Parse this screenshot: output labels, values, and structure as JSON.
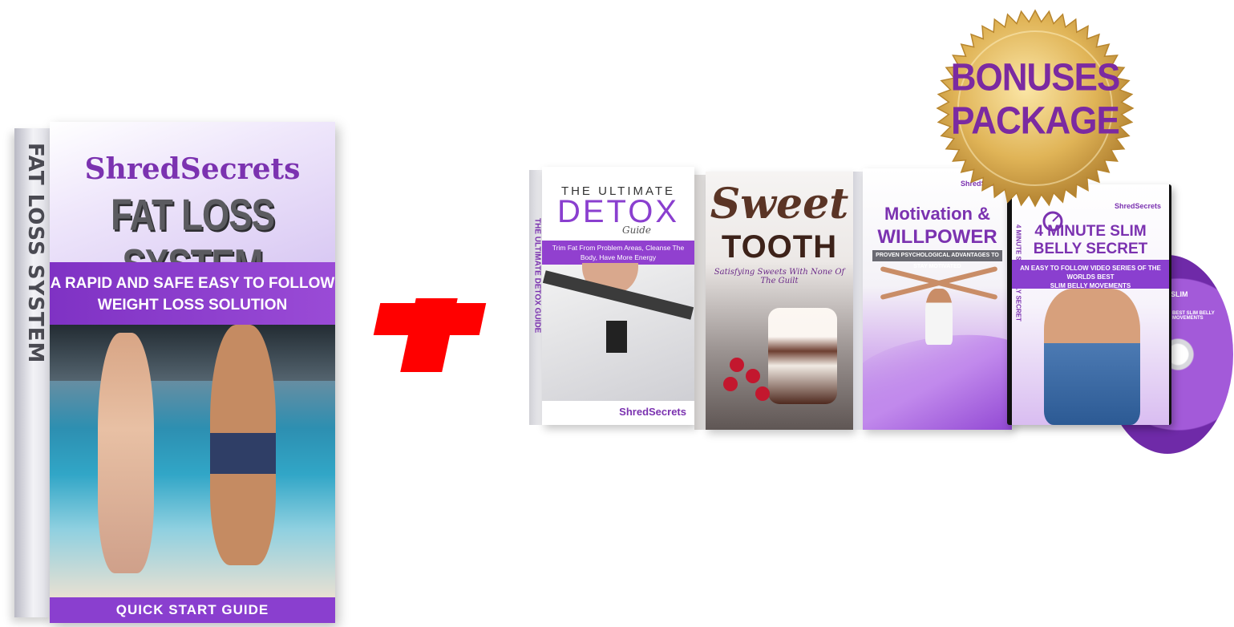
{
  "main_book": {
    "spine_text": "FAT LOSS SYSTEM",
    "brand": "ShredSecrets",
    "title": "FAT LOSS SYSTEM",
    "subtitle_line1": "A RAPID AND SAFE EASY TO FOLLOW",
    "subtitle_line2": "WEIGHT LOSS SOLUTION",
    "footer": "QUICK START GUIDE"
  },
  "plus_symbol": "+",
  "detox_book": {
    "small_title": "THE ULTIMATE",
    "big_title": "DETOX",
    "guide": "Guide",
    "band_line1": "Trim Fat From Problem Areas, Cleanse The",
    "band_line2": "Body, Have More Energy",
    "brand": "ShredSecrets",
    "spine_text": "THE ULTIMATE DETOX GUIDE"
  },
  "sweet_book": {
    "title_line1": "Sweet",
    "title_line2": "TOOTH",
    "tagline": "Satisfying Sweets With None Of The Guilt"
  },
  "motivation_book": {
    "brand": "ShredSecrets",
    "title_line1": "Motivation &",
    "title_line2": "WILLPOWER",
    "band": "PROVEN PSYCHOLOGICAL ADVANTAGES TO STAY MOTIVATED"
  },
  "dvd": {
    "brand": "ShredSecrets",
    "title_line1": "4 MINUTE SLIM",
    "title_line2": "BELLY SECRET",
    "band_line1": "AN EASY TO FOLLOW VIDEO SERIES OF THE WORLDS BEST",
    "band_line2": "SLIM BELLY MOVEMENTS",
    "spine_text": "4 MINUTE SLIM BELLY SECRET",
    "disc_text": "SLIM",
    "disc_small": "BEST SLIM BELLY MOVEMENTS"
  },
  "seal": {
    "line1": "BONUSES",
    "line2": "PACKAGE"
  },
  "colors": {
    "brand_purple": "#8a3fcf",
    "plus_red": "#ff0000",
    "seal_gold": "#d9a94a"
  }
}
